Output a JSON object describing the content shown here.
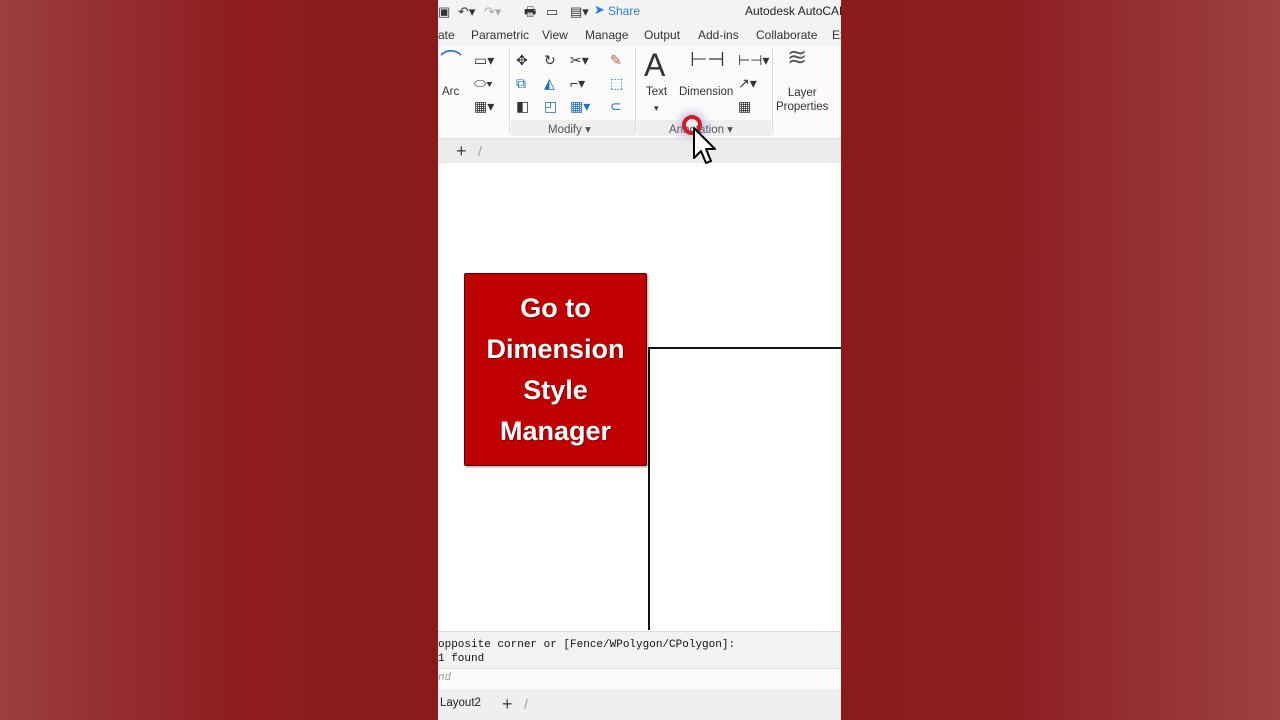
{
  "quick_access": {
    "share_label": "Share",
    "title": "Autodesk AutoCAD"
  },
  "tabs": [
    "ate",
    "Parametric",
    "View",
    "Manage",
    "Output",
    "Add-ins",
    "Collaborate",
    "Ex"
  ],
  "ribbon": {
    "draw": {
      "arc_label": "Arc"
    },
    "modify": {
      "panel_label": "Modify ▾"
    },
    "annotation": {
      "text_label": "Text",
      "dimension_label": "Dimension",
      "panel_label": "Annotation ▾"
    },
    "layers": {
      "layer_properties_label": "Layer\nProperties"
    }
  },
  "callout": {
    "text": "Go to\nDimension\nStyle\nManager"
  },
  "command": {
    "history": [
      "opposite corner or [Fence/WPolygon/CPolygon]:",
      "1 found"
    ],
    "input_placeholder": "nd"
  },
  "layouts": {
    "tab_label": "Layout2"
  },
  "colors": {
    "callout_bg": "#c00000",
    "accent": "#2c7be5",
    "background": "#8e1c1e"
  },
  "icons": [
    "arc-icon",
    "rectangle-icon",
    "ellipse-icon",
    "hatch-icon",
    "move-icon",
    "rotate-icon",
    "trim-icon",
    "erase-icon",
    "copy-icon",
    "mirror-icon",
    "fillet-icon",
    "explode-icon",
    "stretch-icon",
    "scale-icon",
    "array-icon",
    "offset-icon",
    "text-icon",
    "dimension-icon",
    "linear-dim-icon",
    "leader-icon",
    "table-icon",
    "layer-properties-icon",
    "plus-icon",
    "mouse-cursor-icon"
  ]
}
